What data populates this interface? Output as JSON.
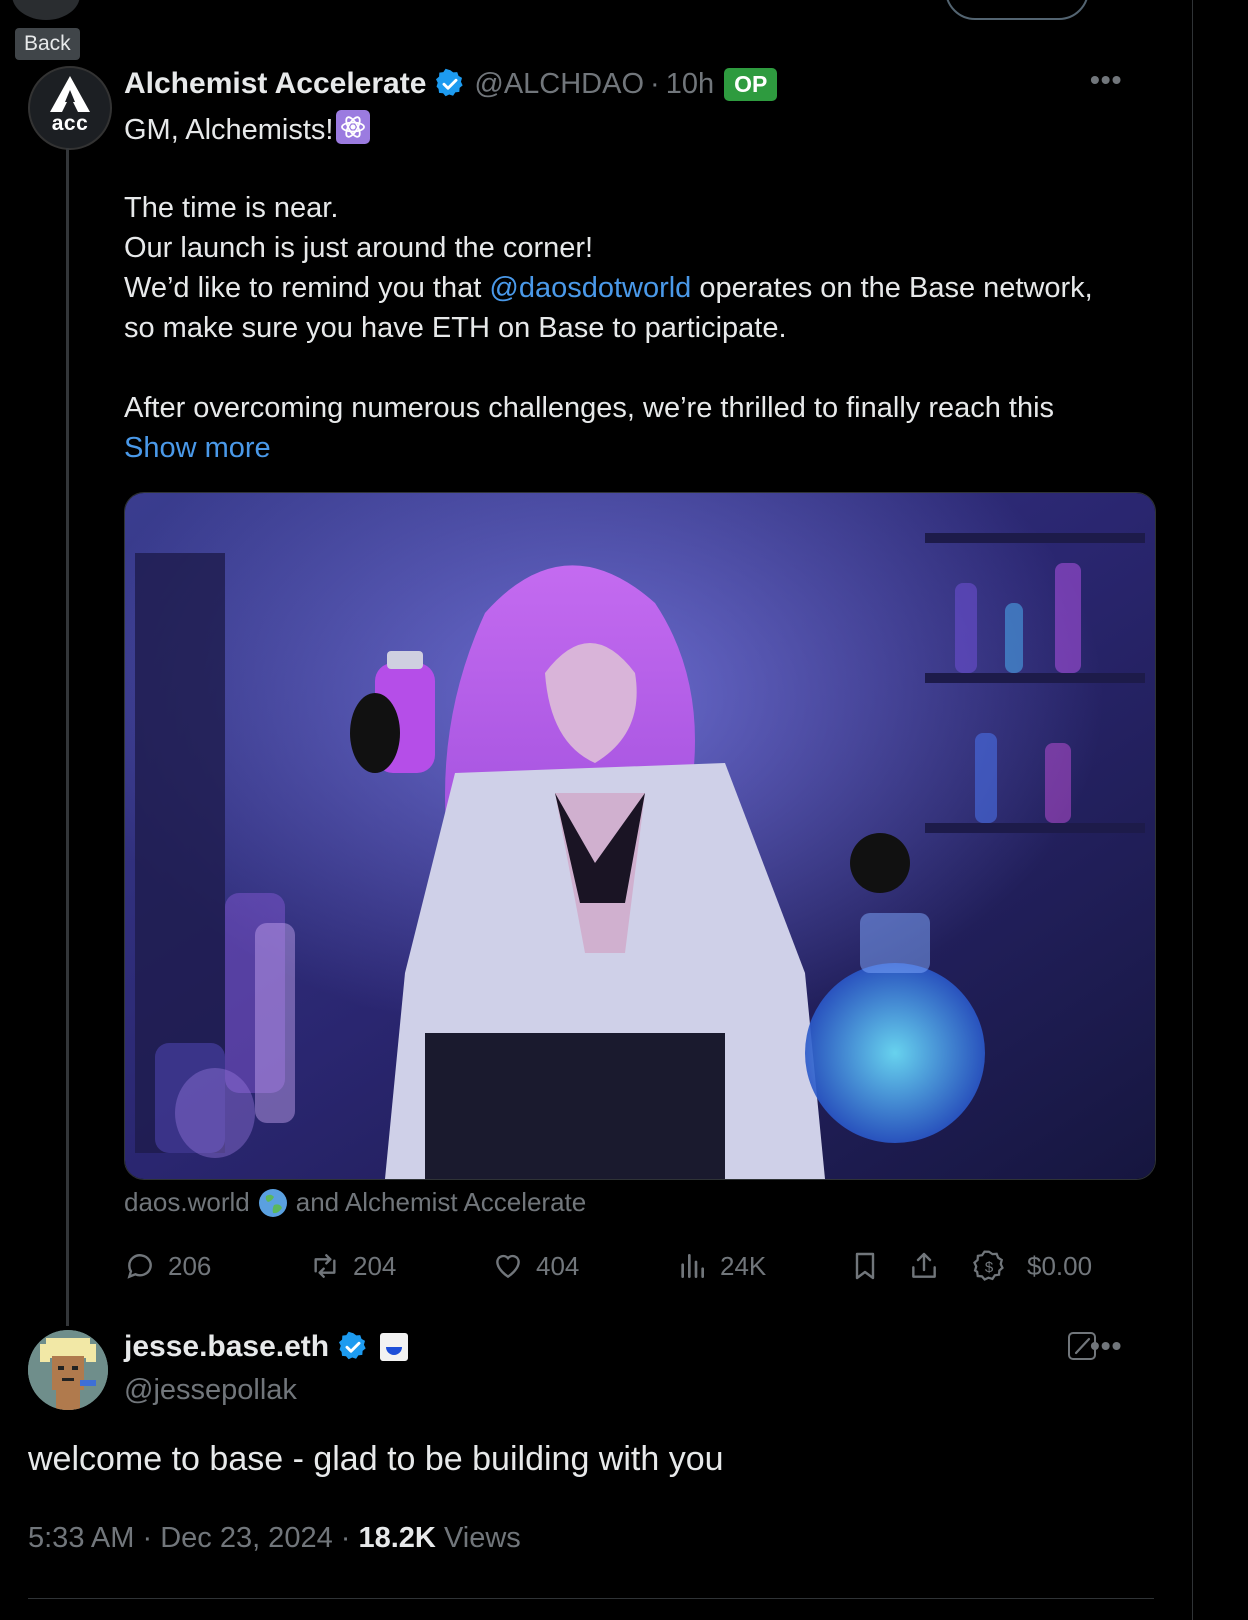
{
  "tooltip": {
    "back_label": "Back"
  },
  "op_tweet": {
    "author": {
      "name": "Alchemist Accelerate",
      "handle": "@ALCHDAO",
      "time": "10h",
      "badge": "OP",
      "avatar_text": "acc"
    },
    "text": {
      "greeting": "GM, Alchemists!",
      "line1": "The time is near.",
      "line2": "Our launch is just around the corner!",
      "line3_pre": "We’d like to remind you that ",
      "line3_mention": "@daosdotworld",
      "line3_post": " operates on the Base network,",
      "line4": "so make sure you have ETH on Base to participate.",
      "line5": "After overcoming numerous challenges, we’re thrilled to finally reach this",
      "show_more": "Show more"
    },
    "tagged": {
      "first": "daos.world",
      "rest": "and Alchemist Accelerate"
    },
    "actions": {
      "replies": "206",
      "reposts": "204",
      "likes": "404",
      "views": "24K",
      "tip": "$0.00"
    }
  },
  "reply_tweet": {
    "author": {
      "name": "jesse.base.eth",
      "handle": "@jessepollak"
    },
    "text": "welcome to base - glad to be building with you",
    "meta": {
      "time": "5:33 AM",
      "date": "Dec 23, 2024",
      "views_count": "18.2K",
      "views_label": "Views"
    }
  },
  "colors": {
    "background": "#000000",
    "text": "#e7e9ea",
    "muted": "#71767b",
    "link": "#4a99e9",
    "verified": "#1d9bf0",
    "op_badge": "#2e9b3f"
  },
  "icons": [
    "verified-badge-icon",
    "atom-emoji-icon",
    "more-icon",
    "reply-icon",
    "repost-icon",
    "like-icon",
    "views-icon",
    "bookmark-icon",
    "share-icon",
    "tip-icon",
    "globe-icon",
    "grok-icon",
    "blue-square-icon"
  ]
}
